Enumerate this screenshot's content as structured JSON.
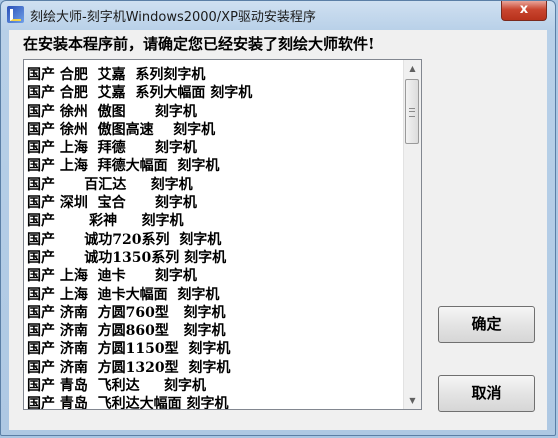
{
  "window": {
    "title": "刻绘大师-刻字机Windows2000/XP驱动安装程序",
    "close_label": "x"
  },
  "prompt": "在安装本程序前，请确定您已经安装了刻绘大师软件!",
  "list_items": [
    "国产 合肥  艾嘉  系列刻字机",
    "国产 合肥  艾嘉  系列大幅面 刻字机",
    "国产 徐州  傲图      刻字机",
    "国产 徐州  傲图高速    刻字机",
    "国产 上海  拜德      刻字机",
    "国产 上海  拜德大幅面  刻字机",
    "国产      百汇达     刻字机",
    "国产 深圳  宝合      刻字机",
    "国产       彩神     刻字机",
    "国产      诚功720系列  刻字机",
    "国产      诚功1350系列 刻字机",
    "国产 上海  迪卡      刻字机",
    "国产 上海  迪卡大幅面  刻字机",
    "国产 济南  方圆760型   刻字机",
    "国产 济南  方圆860型   刻字机",
    "国产 济南  方圆1150型  刻字机",
    "国产 济南  方圆1320型  刻字机",
    "国产 青岛  飞利达     刻字机",
    "国产 青岛  飞利达大幅面 刻字机"
  ],
  "buttons": {
    "ok": "确定",
    "cancel": "取消"
  },
  "scrollbar": {
    "up_icon": "▲",
    "down_icon": "▼"
  }
}
